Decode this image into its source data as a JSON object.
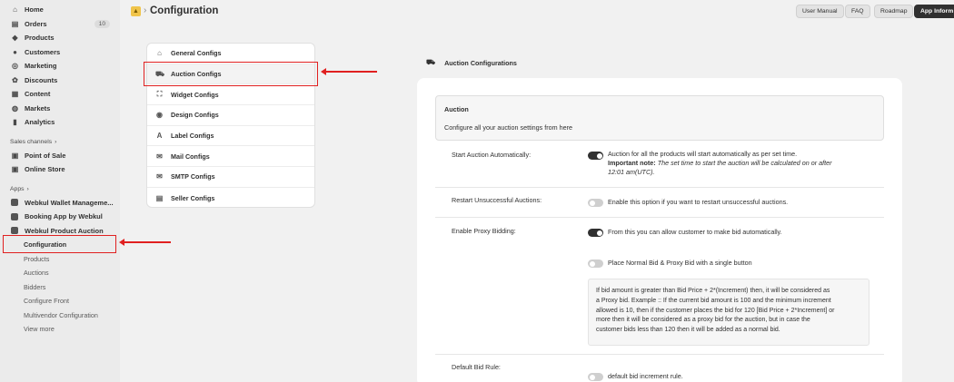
{
  "sidebar": {
    "items": [
      {
        "label": "Home",
        "icon": "home-icon",
        "glyph": "⌂"
      },
      {
        "label": "Orders",
        "icon": "orders-icon",
        "glyph": "▤",
        "badge": "10"
      },
      {
        "label": "Products",
        "icon": "tag-icon",
        "glyph": "◆"
      },
      {
        "label": "Customers",
        "icon": "person-icon",
        "glyph": "●"
      },
      {
        "label": "Marketing",
        "icon": "target-icon",
        "glyph": "◎"
      },
      {
        "label": "Discounts",
        "icon": "discount-icon",
        "glyph": "✿"
      },
      {
        "label": "Content",
        "icon": "content-icon",
        "glyph": "▦"
      },
      {
        "label": "Markets",
        "icon": "globe-icon",
        "glyph": "◍"
      },
      {
        "label": "Analytics",
        "icon": "analytics-icon",
        "glyph": "▮"
      }
    ],
    "sales_channels_label": "Sales channels",
    "channels": [
      {
        "label": "Point of Sale",
        "icon": "pos-icon",
        "glyph": "▣"
      },
      {
        "label": "Online Store",
        "icon": "store-icon",
        "glyph": "▣"
      }
    ],
    "apps_label": "Apps",
    "apps": [
      {
        "label": "Webkul Wallet Manageme..."
      },
      {
        "label": "Booking App by Webkul"
      },
      {
        "label": "Webkul Product Auction"
      }
    ],
    "sub_items": [
      "Configuration",
      "Products",
      "Auctions",
      "Bidders",
      "Configure Front",
      "Multivendor Configuration",
      "View more"
    ]
  },
  "header": {
    "logo_glyph": "▲",
    "separator": "›",
    "title": "Configuration",
    "buttons": [
      "User Manual",
      "FAQ",
      "Roadmap",
      "App Informa"
    ]
  },
  "menu": {
    "items": [
      {
        "label": "General Configs",
        "icon": "home-icon",
        "glyph": "⌂"
      },
      {
        "label": "Auction Configs",
        "icon": "auction-cart-icon",
        "glyph": "⛟"
      },
      {
        "label": "Widget Configs",
        "icon": "widget-icon",
        "glyph": "⛶"
      },
      {
        "label": "Design Configs",
        "icon": "eye-icon",
        "glyph": "◉"
      },
      {
        "label": "Label Configs",
        "icon": "label-icon",
        "glyph": "A"
      },
      {
        "label": "Mail Configs",
        "icon": "mail-icon",
        "glyph": "✉"
      },
      {
        "label": "SMTP Configs",
        "icon": "smtp-icon",
        "glyph": "✉"
      },
      {
        "label": "Seller Configs",
        "icon": "seller-icon",
        "glyph": "▤"
      }
    ]
  },
  "section": {
    "title": "Auction Configurations",
    "glyph": "⛟"
  },
  "auction": {
    "title": "Auction",
    "description": "Configure all your auction settings from here"
  },
  "settings": {
    "start_auto": {
      "label": "Start Auction Automatically:",
      "text": "Auction for all the products will start automatically as per set time.",
      "note_label": "Important note:",
      "note_text": "The set time to start the auction will be calculated on or after",
      "note_text_2": "12:01 am(UTC)."
    },
    "restart": {
      "label": "Restart Unsuccessful Auctions:",
      "text": "Enable this option if you want to restart unsuccessful auctions."
    },
    "proxy": {
      "label": "Enable Proxy Bidding:",
      "text": "From this you can allow customer to make bid automatically."
    },
    "single_button": {
      "text": "Place Normal Bid & Proxy Bid with a single button"
    },
    "info_lines": [
      "If bid amount is greater than Bid Price + 2*(Increment) then, it will be considered as",
      "a Proxy bid. Example :: If the current bid amount is 100 and the minimum increment",
      "allowed is 10, then if the customer places the bid for 120 [Bid Price + 2*Increment] or",
      "more then it will be considered as a proxy bid for the auction, but in case the",
      "customer bids less than 120 then it will be added as a normal bid."
    ],
    "default_rule": {
      "label": "Default Bid Rule:",
      "text": "default bid increment rule."
    }
  },
  "colors": {
    "highlight": "#e02020",
    "toggle_on": "#303030",
    "toggle_off": "#cfcfcf"
  }
}
